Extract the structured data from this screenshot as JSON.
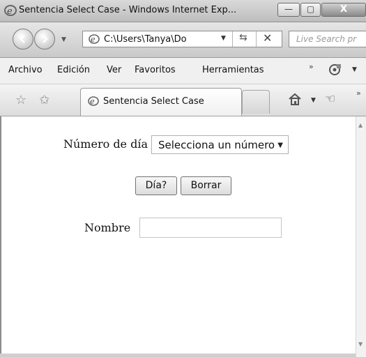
{
  "window": {
    "title": "Sentencia Select Case - Windows Internet Exp...",
    "controls": {
      "minimize": "—",
      "maximize": "▢",
      "close": "X"
    }
  },
  "address_bar": {
    "url": "C:\\Users\\Tanya\\Do",
    "search_placeholder": "Live Search pr"
  },
  "menu": {
    "items": [
      "Archivo",
      "Edición",
      "Ver",
      "Favoritos",
      "Herramientas"
    ],
    "overflow": "»"
  },
  "tabs": {
    "active_label": "Sentencia Select Case",
    "overflow": "»"
  },
  "form": {
    "day_label": "Número de día",
    "day_select_value": "Selecciona un número",
    "dia_button": "Día?",
    "borrar_button": "Borrar",
    "name_label": "Nombre",
    "name_value": ""
  },
  "icons": {
    "ie": "ie-logo-icon",
    "back": "back-arrow-icon",
    "forward": "forward-arrow-icon",
    "refresh": "refresh-icon",
    "stop": "stop-icon",
    "favorites": "star-icon",
    "add_favorites": "add-favorites-icon",
    "home": "home-icon",
    "hand": "hand-icon",
    "tools": "tools-icon"
  }
}
